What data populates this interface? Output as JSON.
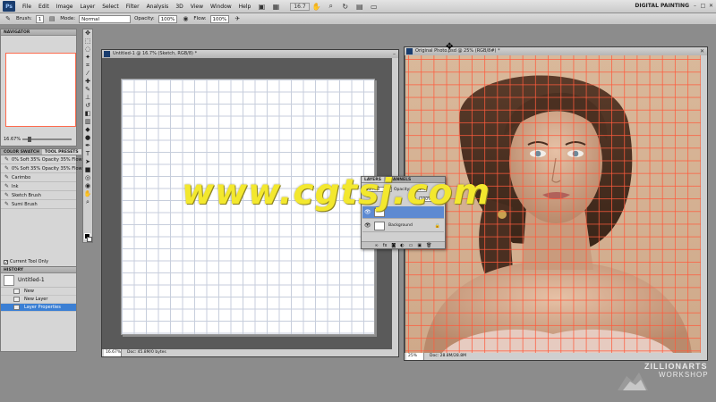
{
  "menubar": {
    "logo": "Ps",
    "items": [
      "File",
      "Edit",
      "Image",
      "Layer",
      "Select",
      "Filter",
      "Analysis",
      "3D",
      "View",
      "Window",
      "Help"
    ],
    "zoom": "16.7",
    "workspace": "DIGITAL PAINTING",
    "controls": [
      "–",
      "□",
      "✕"
    ]
  },
  "options": {
    "brush_label": "Brush:",
    "brush_size": "1",
    "mode_label": "Mode:",
    "mode_value": "Normal",
    "opacity_label": "Opacity:",
    "opacity_value": "100%",
    "flow_label": "Flow:",
    "flow_value": "100%"
  },
  "navigator": {
    "title": "NAVIGATOR",
    "zoom": "16.67%"
  },
  "presets": {
    "tabs": [
      "COLOR SWATCH",
      "TOOL PRESETS"
    ],
    "items": [
      "0% Soft 35% Opacity 35% Flow",
      "0% Soft 35% Opacity 35% Flow",
      "Carimbo",
      "Ink",
      "Sketch Brush",
      "Sumi Brush"
    ],
    "current_tool_only": "Current Tool Only"
  },
  "history": {
    "title": "HISTORY",
    "snapshot": "Untitled-1",
    "items": [
      "New",
      "New Layer",
      "Layer Properties"
    ]
  },
  "sketch_doc": {
    "title": "Untitled-1 @ 16.7% (Sketch, RGB/8) *",
    "zoom": "16.67%",
    "doc_info": "Doc: 45.8M/0 bytes"
  },
  "photo_doc": {
    "title": "Original Photo.psd @ 25% (RGB/8#) *",
    "zoom": "25%",
    "doc_info": "Doc: 28.8M/28.8M"
  },
  "layers": {
    "tabs": [
      "LAYERS",
      "CHANNELS"
    ],
    "blend": "Normal",
    "opacity_label": "Opacity:",
    "opacity": "100%",
    "fill_label": "Fill:",
    "fill": "100%",
    "layer_background": "Background"
  },
  "watermark": "www.cgtsj.com",
  "logo": {
    "line1": "ZILLIONARTS",
    "line2": "WORKSHOP"
  },
  "colors": {
    "grid_red": "#ff5a3c",
    "selection_blue": "#3b7fd4",
    "watermark_yellow": "#f3e82e"
  }
}
